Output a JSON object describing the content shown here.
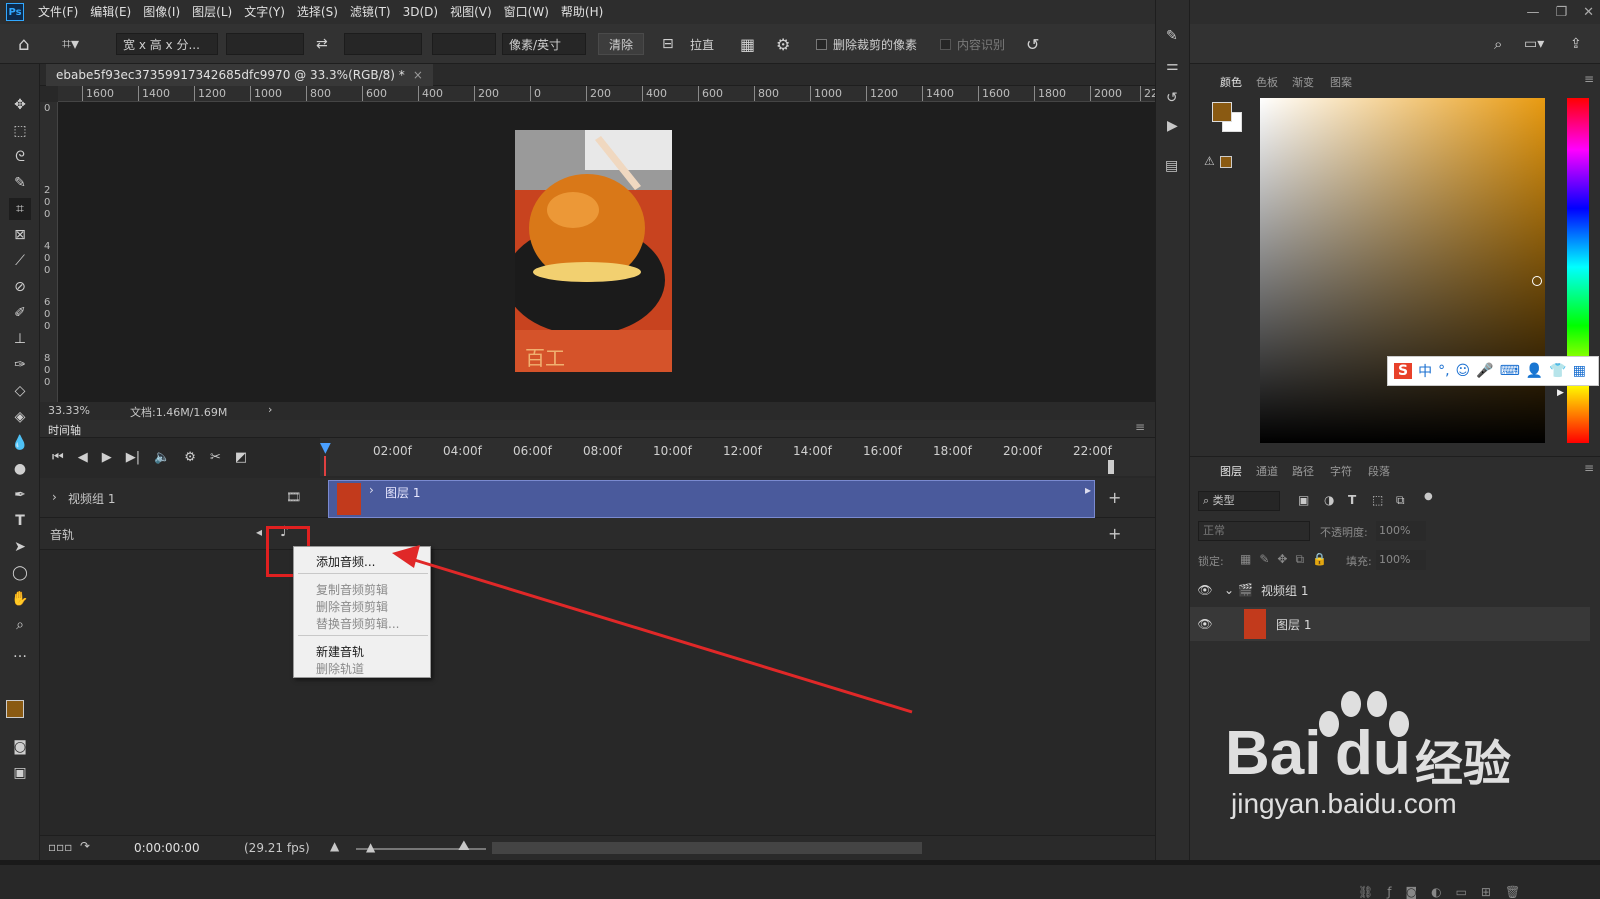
{
  "app": {
    "logo": "Ps"
  },
  "menu": [
    "文件(F)",
    "编辑(E)",
    "图像(I)",
    "图层(L)",
    "文字(Y)",
    "选择(S)",
    "滤镜(T)",
    "3D(D)",
    "视图(V)",
    "窗口(W)",
    "帮助(H)"
  ],
  "options": {
    "ratio_select": "宽 x 高 x 分...",
    "unit_select": "像素/英寸",
    "clear_button": "清除",
    "straighten_label": "拉直",
    "delete_cropped": "删除裁剪的像素",
    "content_aware": "内容识别"
  },
  "document": {
    "tab_title": "ebabe5f93ec37359917342685dfc9970 @ 33.3%(RGB/8) *",
    "zoom": "33.33%",
    "doc_size": "文档:1.46M/1.69M"
  },
  "ruler_h": [
    "1600",
    "1400",
    "1200",
    "1000",
    "800",
    "600",
    "400",
    "200",
    "0",
    "200",
    "400",
    "600",
    "800",
    "1000",
    "1200",
    "1400",
    "1600",
    "1800",
    "2000",
    "22"
  ],
  "ruler_v": [
    "0",
    "2",
    "0",
    "0",
    "4",
    "0",
    "0",
    "6",
    "0",
    "0",
    "8",
    "0",
    "0"
  ],
  "timeline": {
    "panel_title": "时间轴",
    "time_marks": [
      "02:00f",
      "04:00f",
      "06:00f",
      "08:00f",
      "10:00f",
      "12:00f",
      "14:00f",
      "16:00f",
      "18:00f",
      "20:00f",
      "22:00f"
    ],
    "video_group": "视频组 1",
    "clip_name": "图层 1",
    "audio_track": "音轨",
    "current_time": "0:00:00:00",
    "fps": "(29.21 fps)"
  },
  "context_menu": {
    "add_audio": "添加音频...",
    "copy_audio": "复制音频剪辑",
    "delete_audio": "删除音频剪辑",
    "replace_audio": "替换音频剪辑...",
    "new_track": "新建音轨",
    "delete_track": "删除轨道"
  },
  "color_panel": {
    "tabs": [
      "颜色",
      "色板",
      "渐变",
      "图案"
    ],
    "foreground": "#8a5a12",
    "background": "#ffffff"
  },
  "ime": {
    "logo": "S",
    "mode": "中",
    "punct": "°,"
  },
  "layers_panel": {
    "tabs": [
      "图层",
      "通道",
      "路径",
      "字符",
      "段落"
    ],
    "filter": "类型",
    "blend_mode": "正常",
    "opacity_label": "不透明度:",
    "opacity_value": "100%",
    "lock_label": "锁定:",
    "fill_label": "填充:",
    "fill_value": "100%",
    "group": "视频组 1",
    "layer": "图层 1"
  },
  "watermark": {
    "brand": "Bai",
    "brand2": "du",
    "cn": "经验",
    "url": "jingyan.baidu.com"
  }
}
